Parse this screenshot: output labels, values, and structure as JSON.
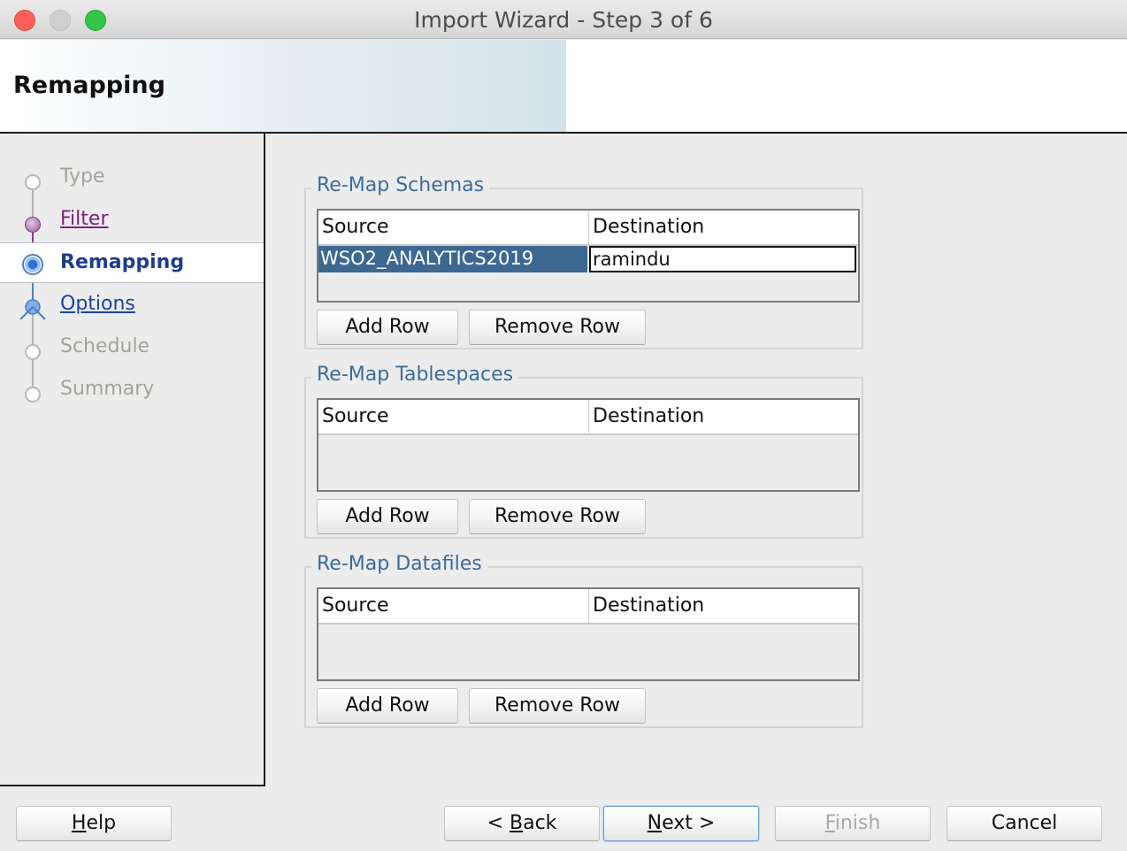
{
  "window": {
    "title": "Import Wizard - Step 3 of 6"
  },
  "header": {
    "title": "Remapping"
  },
  "nav": {
    "items": [
      {
        "label": "Type",
        "state": "disabled"
      },
      {
        "label": "Filter",
        "state": "visited"
      },
      {
        "label": "Remapping",
        "state": "active"
      },
      {
        "label": "Options",
        "state": "link"
      },
      {
        "label": "Schedule",
        "state": "disabled"
      },
      {
        "label": "Summary",
        "state": "disabled"
      }
    ]
  },
  "schemas": {
    "title": "Re-Map Schemas",
    "col_source": "Source",
    "col_destination": "Destination",
    "rows": [
      {
        "source": "WSO2_ANALYTICS2019",
        "destination": "ramindu"
      }
    ],
    "add_row": "Add Row",
    "remove_row": "Remove Row"
  },
  "tablespaces": {
    "title": "Re-Map Tablespaces",
    "col_source": "Source",
    "col_destination": "Destination",
    "add_row": "Add Row",
    "remove_row": "Remove Row"
  },
  "datafiles": {
    "title": "Re-Map Datafiles",
    "col_source": "Source",
    "col_destination": "Destination",
    "add_row": "Add Row",
    "remove_row": "Remove Row"
  },
  "footer": {
    "help_mnemonic": "H",
    "help_rest": "elp",
    "back_prefix": "< ",
    "back_mnemonic": "B",
    "back_rest": "ack",
    "next_mnemonic": "N",
    "next_rest": "ext >",
    "finish_mnemonic": "F",
    "finish_rest": "inish",
    "cancel": "Cancel"
  },
  "colors": {
    "accent": "#3d6891",
    "group_title": "#3b6c9c",
    "visited_link": "#7e2082",
    "link": "#1c43a6"
  }
}
